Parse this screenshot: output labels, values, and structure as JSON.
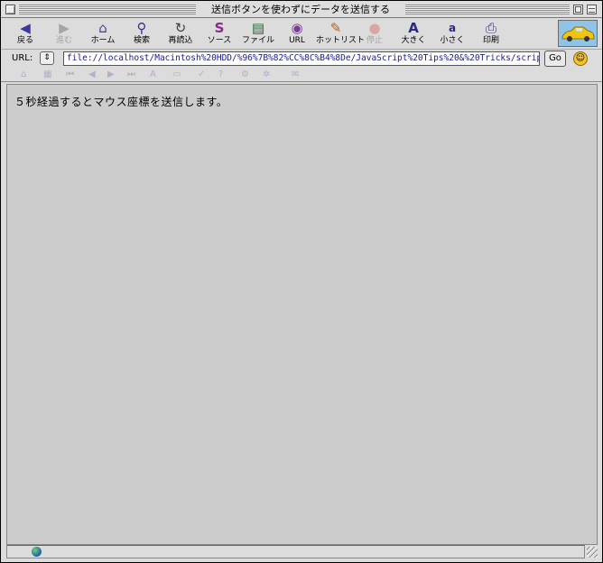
{
  "window": {
    "title": "送信ボタンを使わずにデータを送信する"
  },
  "toolbar": {
    "buttons": [
      {
        "label": "戻る",
        "icon": "back-arrow-icon",
        "glyph": "◀",
        "enabled": true
      },
      {
        "label": "進む",
        "icon": "forward-arrow-icon",
        "glyph": "▶",
        "enabled": false
      },
      {
        "label": "ホーム",
        "icon": "home-icon",
        "glyph": "⌂",
        "enabled": true
      },
      {
        "label": "検索",
        "icon": "search-icon",
        "glyph": "⚲",
        "enabled": true
      },
      {
        "label": "再読込",
        "icon": "reload-icon",
        "glyph": "↻",
        "enabled": true
      },
      {
        "label": "ソース",
        "icon": "source-icon",
        "glyph": "S",
        "enabled": true
      },
      {
        "label": "ファイル",
        "icon": "file-icon",
        "glyph": "▤",
        "enabled": true
      },
      {
        "label": "URL",
        "icon": "url-globe-icon",
        "glyph": "◉",
        "enabled": true
      },
      {
        "label": "ホットリスト",
        "icon": "hotlist-icon",
        "glyph": "✎",
        "enabled": true
      },
      {
        "label": "停止",
        "icon": "stop-icon",
        "glyph": "●",
        "enabled": false
      },
      {
        "label": "大きく",
        "icon": "text-larger-icon",
        "glyph": "A",
        "enabled": true
      },
      {
        "label": "小さく",
        "icon": "text-smaller-icon",
        "glyph": "a",
        "enabled": true
      },
      {
        "label": "印刷",
        "icon": "print-icon",
        "glyph": "⎙",
        "enabled": true
      }
    ]
  },
  "address": {
    "label": "URL:",
    "popup_glyph": "⇕",
    "value": "file://localhost/Macintosh%20HDD/%96%7B%82%CC%8C%B4%8De/JavaScript%20Tips%20&%20Tricks/scrip",
    "go_label": "Go",
    "face_glyph": "☺"
  },
  "content": {
    "text": "５秒経過するとマウス座標を送信します。"
  }
}
